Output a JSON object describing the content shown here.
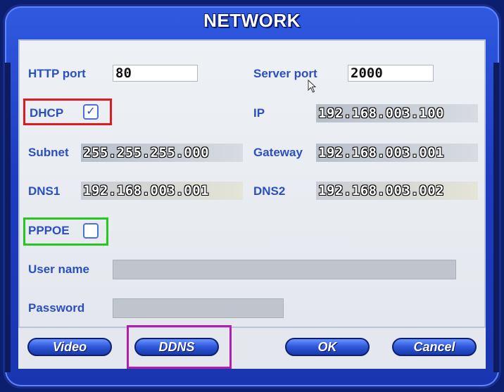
{
  "dialog": {
    "title": "NETWORK"
  },
  "fields": {
    "http_port": {
      "label": "HTTP port",
      "value": "80"
    },
    "server_port": {
      "label": "Server port",
      "value": "2000"
    },
    "dhcp": {
      "label": "DHCP",
      "checked": true,
      "check_glyph": "✓"
    },
    "ip": {
      "label": "IP",
      "value": "192.168.003.100"
    },
    "subnet": {
      "label": "Subnet",
      "value": "255.255.255.000"
    },
    "gateway": {
      "label": "Gateway",
      "value": "192.168.003.001"
    },
    "dns1": {
      "label": "DNS1",
      "value": "192.168.003.001"
    },
    "dns2": {
      "label": "DNS2",
      "value": "192.168.003.002"
    },
    "pppoe": {
      "label": "PPPOE",
      "checked": false
    },
    "user_name": {
      "label": "User name",
      "value": ""
    },
    "password": {
      "label": "Password",
      "value": ""
    }
  },
  "buttons": {
    "video": "Video",
    "ddns": "DDNS",
    "ok": "OK",
    "cancel": "Cancel"
  },
  "colors": {
    "frame": "#1d3cc0",
    "label": "#2a4fbf",
    "highlight_dhcp": "#e01a22",
    "highlight_pppoe": "#26c81f",
    "highlight_ddns": "#b11fb1"
  }
}
